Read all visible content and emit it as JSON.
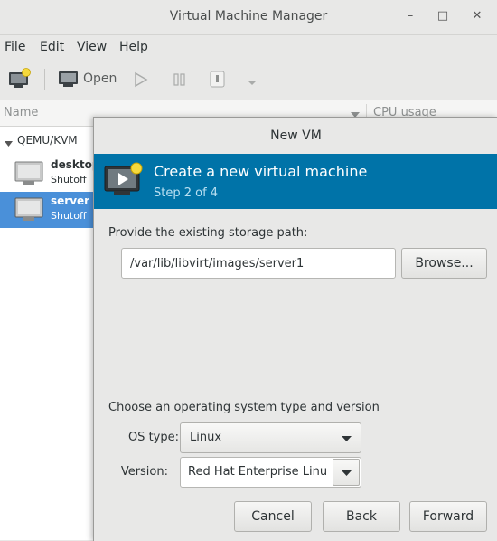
{
  "window": {
    "title": "Virtual Machine Manager",
    "minimize": "–",
    "maximize": "□",
    "close": "✕"
  },
  "menubar": {
    "items": [
      "File",
      "Edit",
      "View",
      "Help"
    ]
  },
  "toolbar": {
    "open_label": "Open"
  },
  "list": {
    "columns": [
      "Name",
      "CPU usage"
    ],
    "connection": "QEMU/KVM",
    "vms": [
      {
        "name": "desktop",
        "status": "Shutoff"
      },
      {
        "name": "server",
        "status": "Shutoff"
      }
    ]
  },
  "dialog": {
    "title": "New VM",
    "banner_title": "Create a new virtual machine",
    "banner_step": "Step 2 of 4",
    "storage_label": "Provide the existing storage path:",
    "storage_value": "/var/lib/libvirt/images/server1",
    "browse_label": "Browse...",
    "os_section_label": "Choose an operating system type and version",
    "os_type_label": "OS type:",
    "os_type_value": "Linux",
    "version_label": "Version:",
    "version_value": "Red Hat Enterprise Linu",
    "cancel_label": "Cancel",
    "back_label": "Back",
    "forward_label": "Forward"
  },
  "colors": {
    "banner": "#0073a8",
    "selection": "#4a90d9"
  }
}
